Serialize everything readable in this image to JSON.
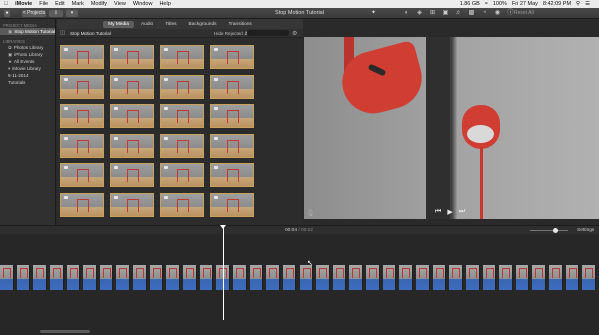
{
  "menubar": {
    "apple": "",
    "items": [
      "iMovie",
      "File",
      "Edit",
      "Mark",
      "Modify",
      "View",
      "Window",
      "Help"
    ],
    "status": [
      "1.86 GB",
      "100%",
      "Fri 27 May",
      "8:42:09 PM"
    ]
  },
  "toolbar": {
    "projects_label": "< Projects",
    "project_title": "Stop Motion Tutorial",
    "reset_all": "Reset All",
    "icons": [
      "magic-wand-icon",
      "color-balance-icon",
      "color-correction-icon",
      "crop-icon",
      "stabilization-icon",
      "volume-icon",
      "noise-reduction-icon",
      "speed-icon",
      "filter-icon",
      "info-icon"
    ]
  },
  "sidebar": {
    "project_media_heading": "PROJECT MEDIA",
    "project_item": "Stop Motion Tutorial",
    "libraries_heading": "LIBRARIES",
    "items": [
      "Photos Library",
      "iPhoto Library",
      "All Events",
      "iMovie Library",
      "5-11-2014",
      "Tutorials"
    ]
  },
  "browser": {
    "tabs": [
      "My Media",
      "Audio",
      "Titles",
      "Backgrounds",
      "Transitions"
    ],
    "active_tab": "My Media",
    "project_label": "Stop Motion Tutorial",
    "filter_label": "Hide Rejected",
    "thumb_count": 24
  },
  "timeline": {
    "current_time": "00:04",
    "separator": "/",
    "total_time": "00:22",
    "settings_label": "Settings",
    "clip_count": 36
  },
  "viewer": {
    "controls": [
      "skip-back-icon",
      "play-icon",
      "skip-forward-icon"
    ]
  }
}
